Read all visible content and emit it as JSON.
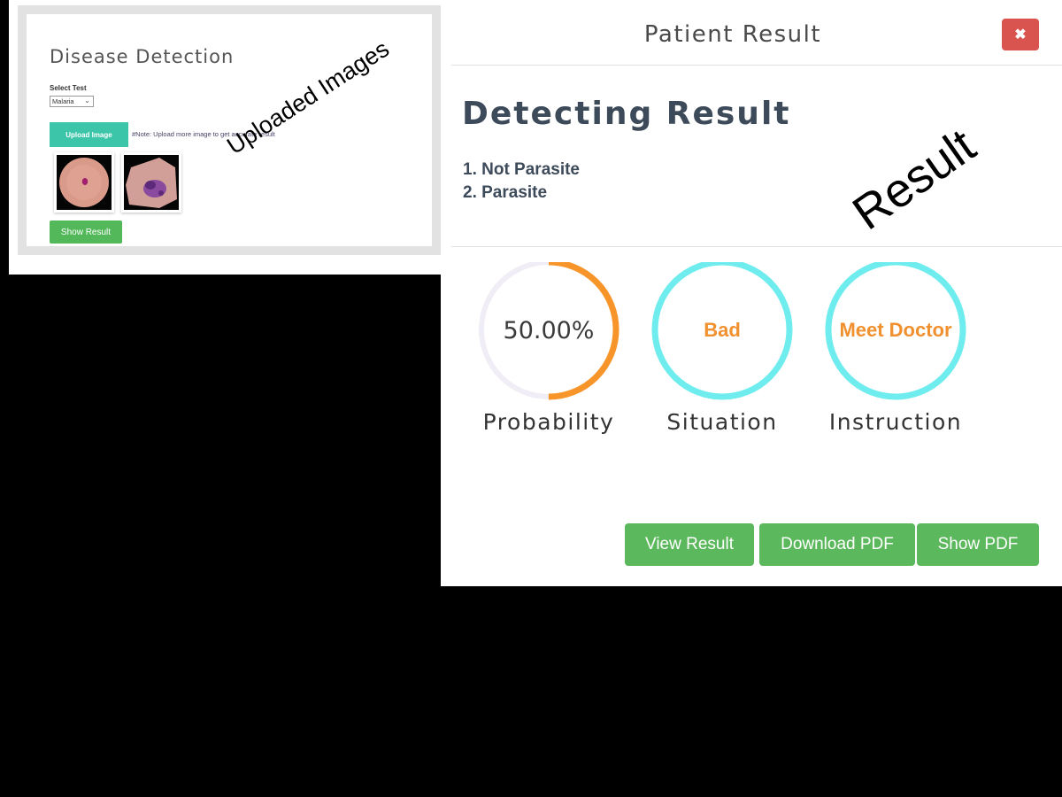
{
  "left_panel": {
    "title": "Disease Detection",
    "select_label": "Select Test",
    "select_value": "Malaria",
    "upload_button": "Upload Image",
    "note": "#Note: Upload more image to get accurate result",
    "images": [
      {
        "name": "uninfected-cell-image"
      },
      {
        "name": "parasitized-cell-image"
      }
    ],
    "show_result_button": "Show Result",
    "annotation": "Uploaded Images"
  },
  "modal": {
    "title": "Patient Result",
    "close_icon": "close-icon",
    "heading": "Detecting Result",
    "results": [
      "1. Not Parasite",
      "2. Parasite"
    ],
    "annotation": "Result",
    "gauges": [
      {
        "value": "50.00%",
        "fraction": 0.5,
        "caption": "Probability",
        "color": "#f7952a"
      },
      {
        "value": "Bad",
        "fraction": 1.0,
        "caption": "Situation",
        "color": "#6eecee"
      },
      {
        "value": "Meet Doctor",
        "fraction": 1.0,
        "caption": "Instruction",
        "color": "#6eecee"
      }
    ],
    "buttons": {
      "view_result": "View Result",
      "download_pdf": "Download PDF",
      "show_pdf": "Show PDF"
    }
  },
  "colors": {
    "teal_button": "#3cc5a9",
    "green_button": "#5cb85c",
    "close_button": "#d9534f",
    "orange_text": "#f0902e",
    "cyan_ring": "#6eecee"
  }
}
